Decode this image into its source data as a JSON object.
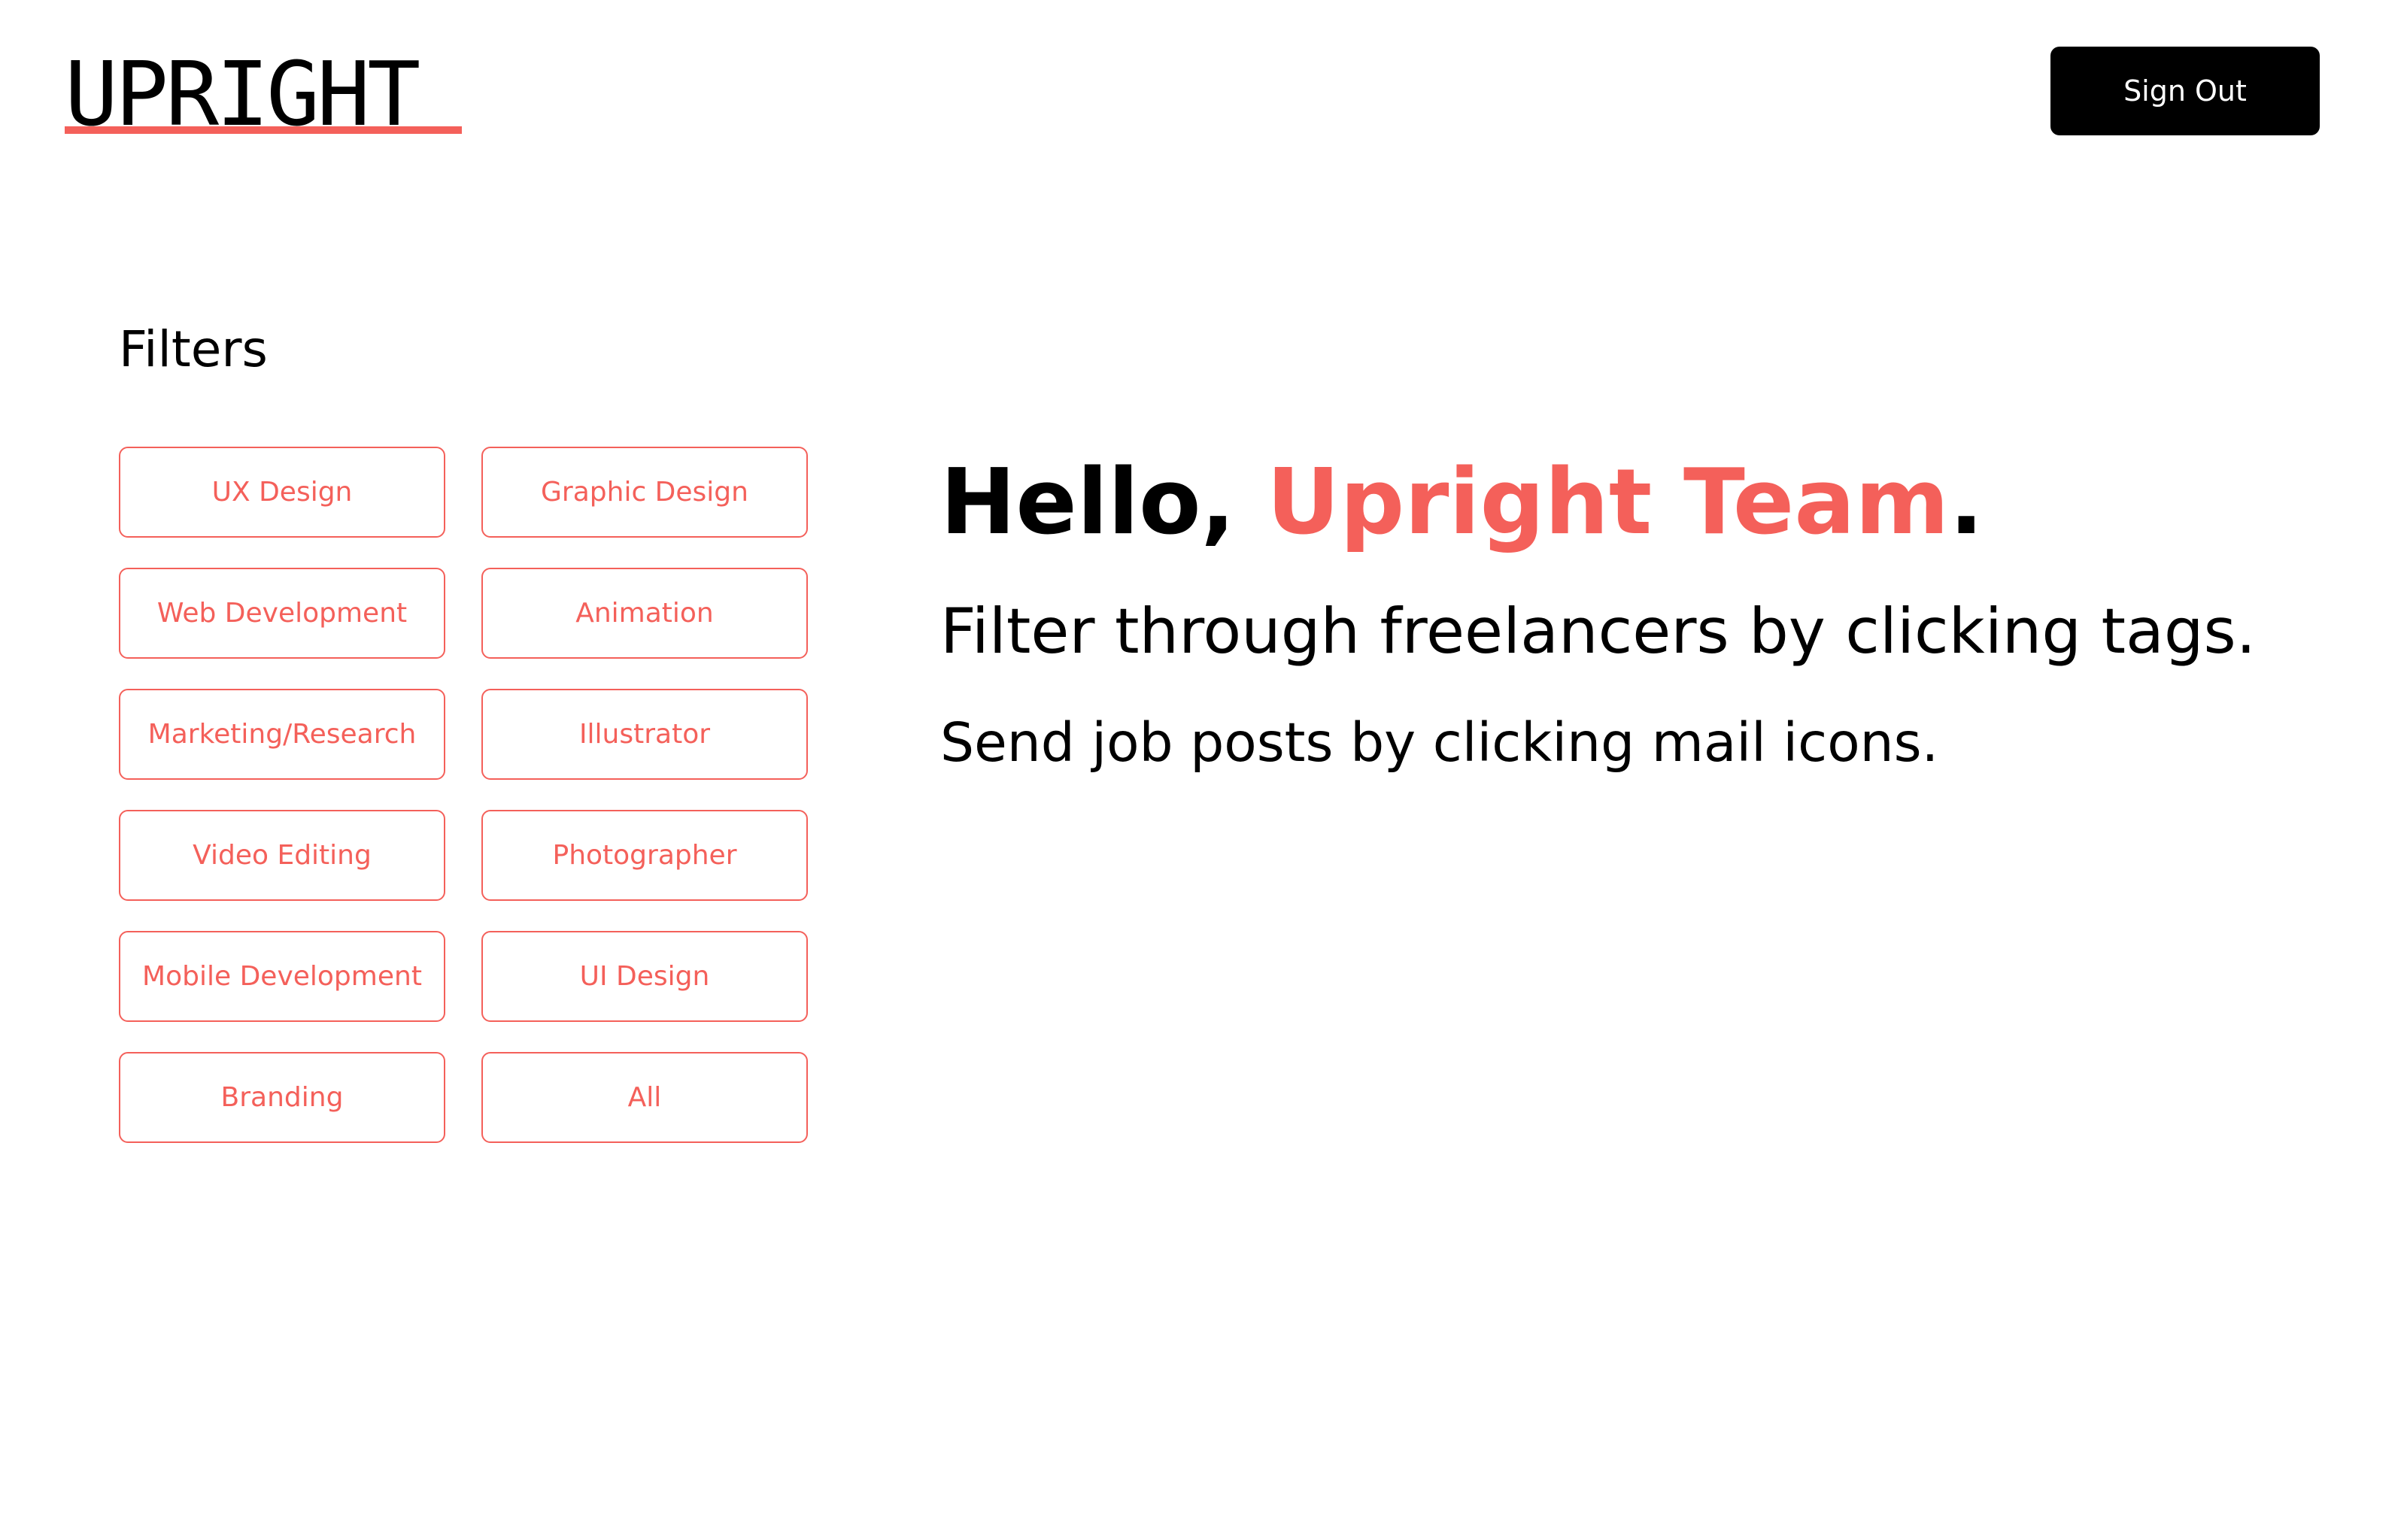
{
  "header": {
    "logo_text": "UPRIGHT",
    "sign_out_label": "Sign Out"
  },
  "sidebar": {
    "heading": "Filters",
    "tags": [
      "UX Design",
      "Graphic Design",
      "Web Development",
      "Animation",
      "Marketing/Research",
      "Illustrator",
      "Video Editing",
      "Photographer",
      "Mobile Development",
      "UI Design",
      "Branding",
      "All"
    ]
  },
  "main": {
    "greeting_prefix": "Hello, ",
    "greeting_name": "Upright Team",
    "greeting_suffix": ".",
    "subheading": "Filter through freelancers by clicking tags.",
    "info": "Send job posts by clicking mail icons."
  },
  "colors": {
    "accent": "#F4605A",
    "text": "#000000",
    "background": "#FFFFFF",
    "button": "#000000"
  }
}
